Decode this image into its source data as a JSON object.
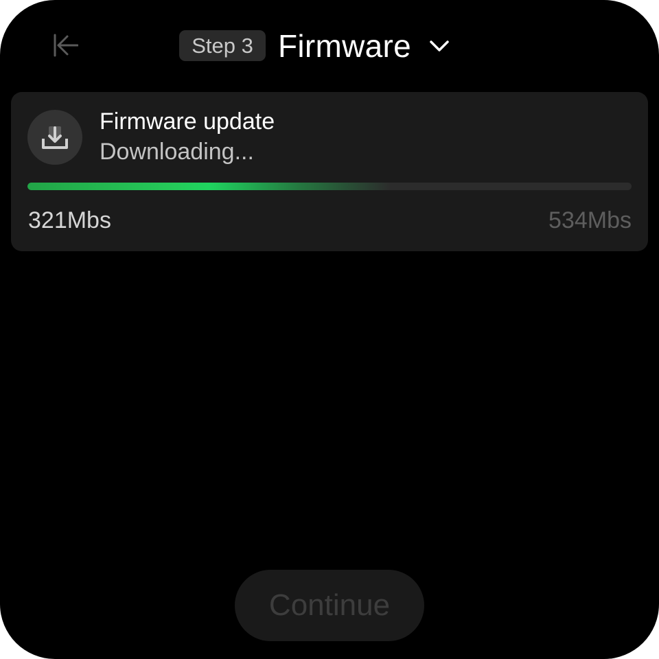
{
  "header": {
    "step_badge": "Step 3",
    "title": "Firmware",
    "back_icon": "back-arrow-icon",
    "dropdown_icon": "chevron-down-icon"
  },
  "update_card": {
    "icon": "download-icon",
    "title": "Firmware update",
    "status": "Downloading...",
    "downloaded": "321Mbs",
    "total": "534Mbs",
    "progress_fraction": 0.601
  },
  "footer": {
    "continue_label": "Continue",
    "continue_enabled": false
  },
  "colors": {
    "background": "#000000",
    "card": "#1b1b1b",
    "progress_accent": "#1fd45f",
    "badge": "#2a2a2a"
  }
}
